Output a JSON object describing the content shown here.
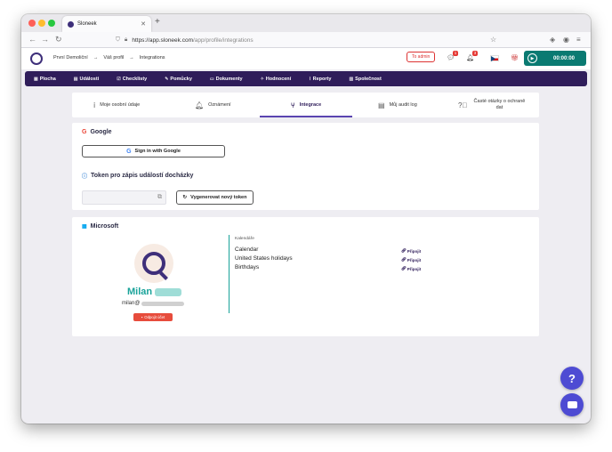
{
  "browser": {
    "tab_title": "Sloneek",
    "url_host": "https://app.sloneek.com",
    "url_path": "/app/profile/integrations"
  },
  "header": {
    "breadcrumbs": [
      "První Demoliční",
      "→",
      "Váš profil",
      "→",
      "Integrations"
    ],
    "to_admin": "To admin",
    "notification_count_1": "1",
    "notification_count_2": "3",
    "timer": "00:00:00"
  },
  "mainnav": [
    {
      "icon": "home-icon",
      "label": "Plocha"
    },
    {
      "icon": "calendar-icon",
      "label": "Události"
    },
    {
      "icon": "checklist-icon",
      "label": "Checklisty"
    },
    {
      "icon": "tools-icon",
      "label": "Pomůcky"
    },
    {
      "icon": "document-icon",
      "label": "Dokumenty"
    },
    {
      "icon": "rating-icon",
      "label": "Hodnocení"
    },
    {
      "icon": "chart-icon",
      "label": "Reporty"
    },
    {
      "icon": "company-icon",
      "label": "Společnost"
    }
  ],
  "profile_tabs": [
    {
      "label": "Moje osobní údaje"
    },
    {
      "label": "Oznámení"
    },
    {
      "label": "Integrace"
    },
    {
      "label": "Můj audit log"
    },
    {
      "label": "Časté otázky o ochraně dat"
    }
  ],
  "google": {
    "title": "Google",
    "sign_in": "Sign in with Google",
    "token_title": "Token pro zápis událostí docházky",
    "generate": "Vygenerovat nový token"
  },
  "microsoft": {
    "title": "Microsoft",
    "user_name": "Milan",
    "user_email": "milan@",
    "disconnect": "Odpojit účet",
    "calendars_header": "Kalendáře",
    "calendars": [
      {
        "name": "Calendar",
        "action": "Připojit"
      },
      {
        "name": "United States holidays",
        "action": "Připojit"
      },
      {
        "name": "Birthdays",
        "action": "Připojit"
      }
    ]
  },
  "fab": {
    "help": "?",
    "chat": "chat-icon"
  },
  "colors": {
    "primary": "#2f1d5a",
    "accent_teal": "#0a7a72",
    "user_name_teal": "#1aa39a",
    "danger": "#e74c3c",
    "fab": "#4e4bd3"
  }
}
